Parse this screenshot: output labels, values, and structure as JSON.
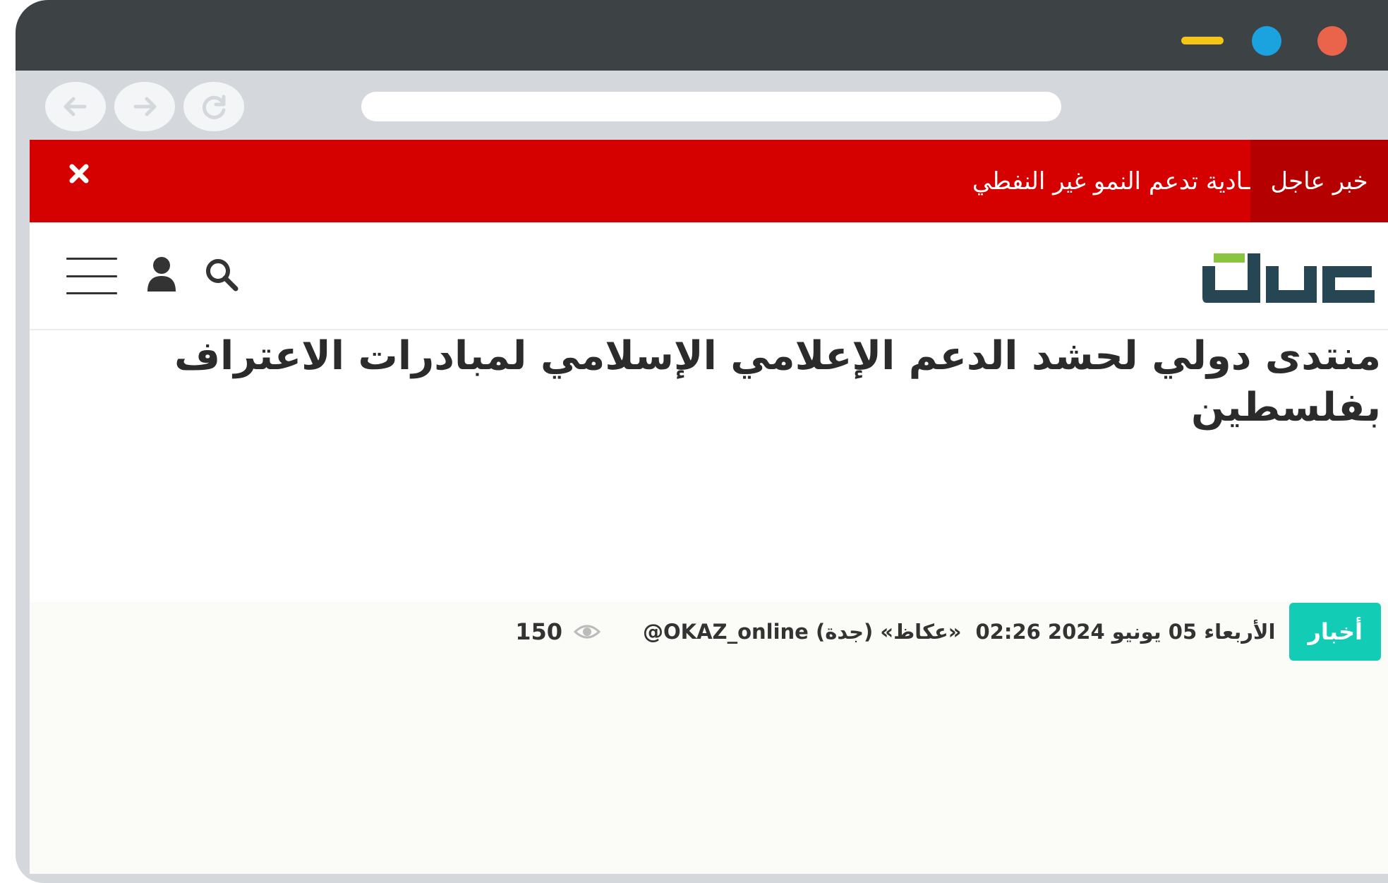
{
  "window": {
    "controls": [
      "minimize-icon",
      "maximize-icon",
      "close-icon"
    ],
    "colors": {
      "minimize": "#f5c518",
      "maximize": "#1ba3e0",
      "close": "#e9644b",
      "titlebar": "#3d4244"
    }
  },
  "browser_nav": {
    "buttons": [
      "back-arrow-icon",
      "forward-arrow-icon",
      "reload-icon"
    ],
    "address": ""
  },
  "breaking": {
    "label": "خبر عاجل",
    "text": "ـادية تدعم النمو غير النفطي",
    "close_icon": "close-icon",
    "colors": {
      "bar": "#d50000",
      "label_bg": "#b50000"
    }
  },
  "header": {
    "logo_text": "عكاظ",
    "icons": [
      "search-icon",
      "user-icon",
      "hamburger-menu-icon"
    ]
  },
  "article": {
    "title": "منتدى دولي لحشد الدعم الإعلامي الإسلامي لمبادرات الاعتراف بفلسطين",
    "category": "أخبار",
    "date": "الأربعاء 05 يونيو 2024 02:26",
    "source": "«عكاظ» (جدة) OKAZ_online@",
    "views": "150",
    "colors": {
      "badge": "#12ccb5"
    }
  }
}
